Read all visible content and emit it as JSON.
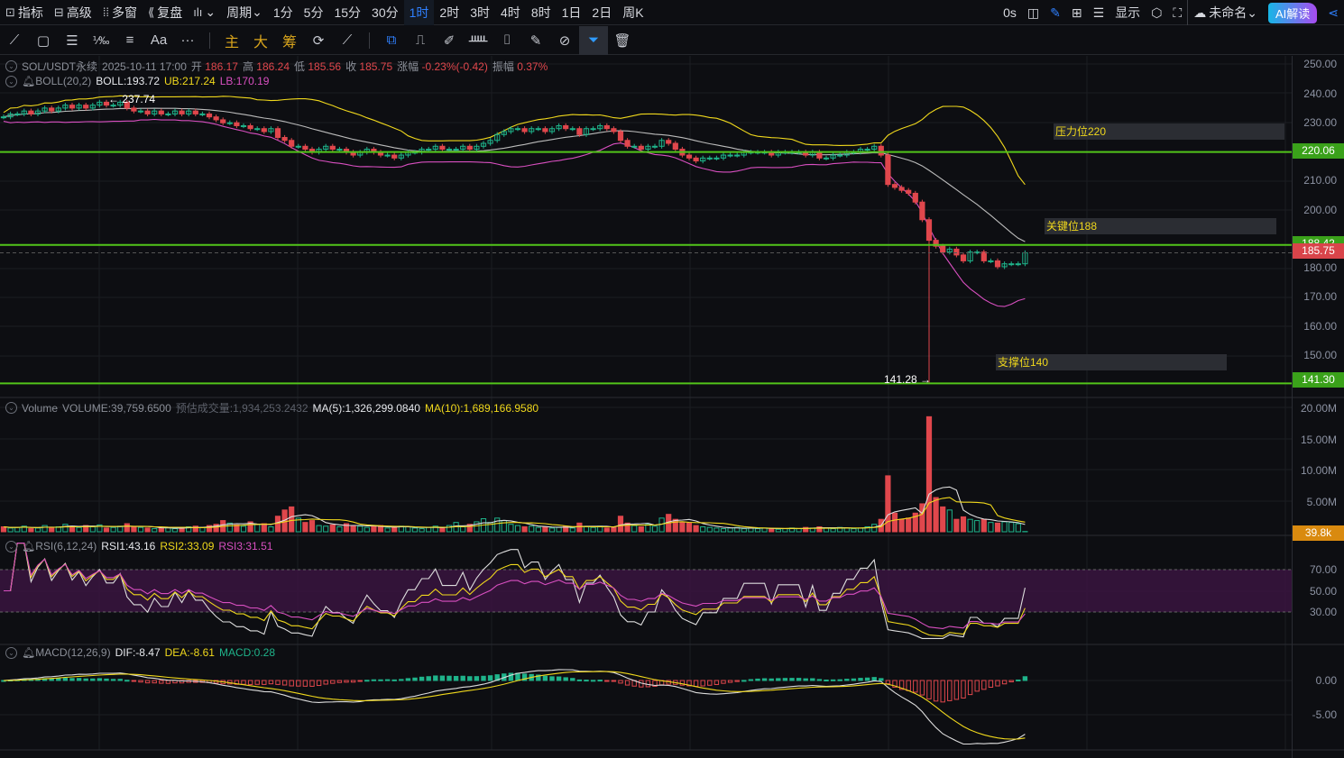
{
  "topbar": {
    "items": [
      {
        "icon": "indicator-icon",
        "label": "指标"
      },
      {
        "icon": "advanced-icon",
        "label": "高级"
      },
      {
        "icon": "multi-window-icon",
        "label": "多窗"
      },
      {
        "icon": "replay-icon",
        "label": "复盘"
      }
    ],
    "chart_type": "K线",
    "period_label": "周期",
    "intervals": [
      "1分",
      "5分",
      "15分",
      "30分",
      "1时",
      "2时",
      "3时",
      "4时",
      "8时",
      "1日",
      "2日",
      "周K"
    ],
    "active_interval": "1时",
    "countdown": "0s",
    "display_label": "显示",
    "layout_name": "未命名",
    "ai_label": "AI解读"
  },
  "toolbar": {
    "main": "主",
    "big": "大",
    "chips": "筹",
    "text_tool": "Aa",
    "more": "···"
  },
  "info": {
    "symbol": "SOL/USDT永续",
    "time": "2025-10-11 17:00",
    "open_label": "开",
    "open": "186.17",
    "high_label": "高",
    "high": "186.24",
    "low_label": "低",
    "low": "185.56",
    "close_label": "收",
    "close": "185.75",
    "change_label": "涨幅",
    "change": "-0.23%(-0.42)",
    "amp_label": "振幅",
    "amp": "0.37%"
  },
  "boll": {
    "name": "BOLL(20,2)",
    "mid": "BOLL:193.72",
    "ub": "UB:217.24",
    "lb": "LB:170.19"
  },
  "volume": {
    "name": "Volume",
    "vol": "VOLUME:39,759.6500",
    "est": "预估成交量:1,934,253.2432",
    "ma5": "MA(5):1,326,299.0840",
    "ma10": "MA(10):1,689,166.9580"
  },
  "rsi": {
    "name": "RSI(6,12,24)",
    "r1": "RSI1:43.16",
    "r2": "RSI2:33.09",
    "r3": "RSI3:31.51"
  },
  "macd": {
    "name": "MACD(12,26,9)",
    "dif": "DIF:-8.47",
    "dea": "DEA:-8.61",
    "macd": "MACD:0.28"
  },
  "annotations": {
    "resist": "压力位220",
    "key": "关键位188",
    "support": "支撑位140",
    "high_mark": "← 237.74",
    "low_mark": "141.28 →"
  },
  "axis": {
    "price_ticks": [
      "250.00",
      "240.00",
      "230.00",
      "210.00",
      "200.00",
      "180.00",
      "170.00",
      "160.00",
      "150.00"
    ],
    "vol_ticks": [
      "20.00M",
      "15.00M",
      "10.00M",
      "5.00M"
    ],
    "rsi_ticks": [
      "70.00",
      "50.00",
      "30.00"
    ],
    "macd_ticks": [
      "0.00",
      "-5.00"
    ],
    "tags": {
      "l220": "220.06",
      "l188": "188.42",
      "last": "185.75",
      "l141": "141.30",
      "vol": "39.8k"
    }
  },
  "colors": {
    "up": "#1fb38a",
    "down": "#e0474c",
    "line_green": "#52c41a",
    "yellow": "#f0d81c",
    "pink": "#d84fc0"
  },
  "chart_data": {
    "type": "candlestick",
    "symbol": "SOL/USDT",
    "interval": "1h",
    "h_lines": [
      220.06,
      188.42,
      141.3
    ],
    "low_point": 141.28,
    "high_point": 237.74,
    "closes": [
      232,
      233,
      233,
      234,
      233,
      234,
      235,
      234,
      235,
      236,
      235,
      236,
      235,
      236,
      237,
      236,
      236,
      237,
      235,
      234,
      234,
      233,
      234,
      233,
      233,
      234,
      233,
      234,
      233,
      233,
      232,
      231,
      230,
      230,
      229,
      229,
      228,
      228,
      227,
      228,
      225,
      224,
      222,
      222,
      221,
      220,
      221,
      222,
      221,
      221,
      220,
      219,
      220,
      221,
      220,
      219,
      219,
      218,
      219,
      220,
      220,
      221,
      221,
      222,
      221,
      221,
      221,
      222,
      221,
      222,
      223,
      224,
      226,
      227,
      228,
      228,
      227,
      228,
      228,
      227,
      228,
      229,
      228,
      228,
      226,
      228,
      228,
      229,
      228,
      227,
      224,
      222,
      222,
      221,
      222,
      222,
      224,
      223,
      221,
      219,
      218,
      217,
      218,
      218,
      218,
      219,
      219,
      219,
      220,
      220,
      220,
      220,
      219,
      220,
      220,
      220,
      220,
      219,
      220,
      218,
      218,
      219,
      219,
      220,
      220,
      221,
      221,
      222,
      219,
      209,
      208,
      207,
      206,
      203,
      197,
      190,
      188,
      186,
      187,
      185,
      183,
      186,
      186,
      183,
      183,
      181,
      182,
      182,
      182,
      185.75
    ],
    "volumes_m": [
      0.8,
      0.6,
      0.7,
      0.9,
      0.5,
      0.6,
      1.0,
      0.7,
      0.8,
      1.2,
      0.9,
      0.7,
      1.0,
      0.8,
      1.1,
      0.6,
      0.7,
      0.9,
      1.3,
      0.8,
      0.7,
      0.6,
      0.5,
      0.6,
      0.7,
      0.5,
      0.6,
      0.8,
      0.9,
      0.7,
      1.0,
      1.2,
      1.8,
      1.4,
      1.1,
      0.9,
      1.6,
      1.2,
      1.3,
      0.8,
      2.5,
      3.5,
      4.0,
      2.2,
      1.5,
      1.8,
      1.0,
      0.9,
      1.1,
      0.8,
      1.3,
      1.0,
      0.9,
      0.7,
      0.8,
      1.0,
      0.6,
      0.7,
      0.9,
      0.8,
      0.6,
      0.5,
      0.7,
      0.9,
      0.6,
      1.0,
      1.5,
      0.8,
      1.2,
      1.6,
      2.1,
      1.5,
      2.2,
      1.8,
      1.2,
      1.0,
      0.8,
      0.9,
      0.7,
      0.8,
      0.6,
      0.7,
      0.9,
      0.6,
      1.4,
      0.8,
      0.7,
      0.9,
      0.6,
      0.8,
      2.5,
      1.4,
      1.0,
      0.8,
      1.2,
      0.9,
      2.2,
      2.8,
      2.0,
      1.5,
      1.4,
      1.0,
      0.8,
      0.7,
      0.6,
      0.5,
      0.6,
      0.7,
      0.5,
      0.6,
      0.5,
      0.6,
      0.5,
      0.4,
      0.5,
      0.6,
      0.5,
      0.7,
      0.6,
      0.8,
      0.6,
      0.5,
      0.7,
      0.6,
      0.5,
      0.6,
      0.8,
      1.2,
      2.0,
      9.0,
      3.0,
      2.0,
      2.2,
      3.0,
      4.5,
      18.5,
      5.5,
      4.0,
      3.5,
      2.0,
      2.4,
      2.0,
      1.8,
      2.0,
      1.5,
      1.4,
      1.6,
      1.5,
      1.3,
      0.04
    ],
    "price_range": [
      136,
      252
    ],
    "vol_range": [
      0,
      20
    ],
    "rsi_range": [
      0,
      100
    ],
    "macd_range": [
      -10,
      2
    ]
  }
}
